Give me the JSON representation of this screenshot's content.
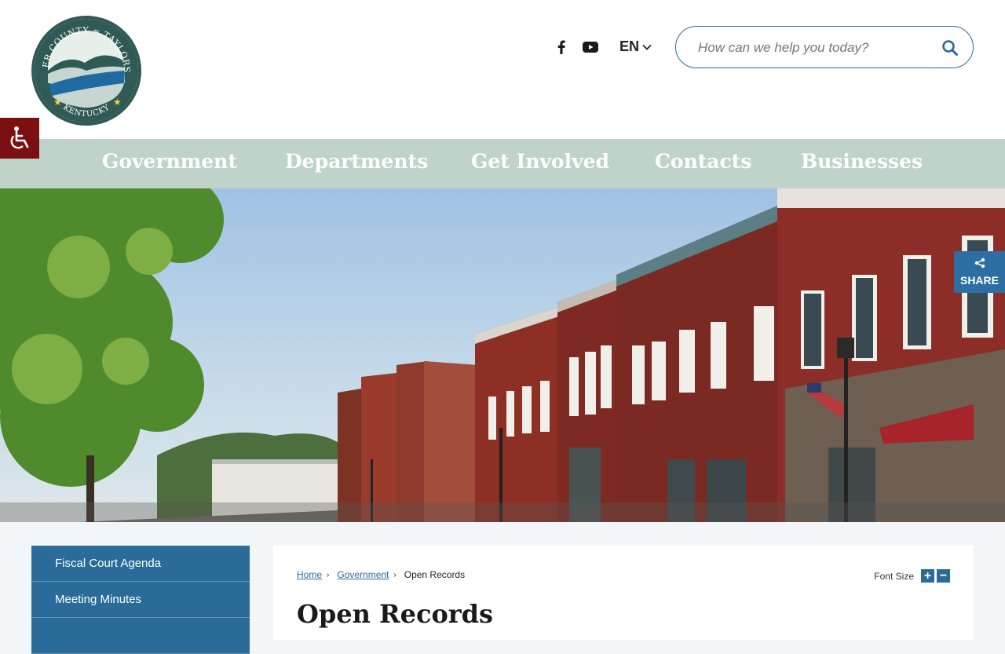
{
  "logo": {
    "top_text": "SPENCER COUNTY ≈ TAYLORSVILLE",
    "bottom_text": "KENTUCKY"
  },
  "header": {
    "social": [
      {
        "icon": "facebook-icon"
      },
      {
        "icon": "youtube-icon"
      }
    ],
    "language": "EN",
    "search_placeholder": "How can we help you today?"
  },
  "nav": {
    "items": [
      "Government",
      "Departments",
      "Get Involved",
      "Contacts",
      "Businesses"
    ]
  },
  "share": {
    "label": "SHARE"
  },
  "sidebar": {
    "items": [
      "Fiscal Court Agenda",
      "Meeting Minutes"
    ]
  },
  "breadcrumb": {
    "home": "Home",
    "parent": "Government",
    "current": "Open Records"
  },
  "font_size": {
    "label": "Font Size"
  },
  "page": {
    "title": "Open Records"
  },
  "colors": {
    "nav_bg": "#bfd3cb",
    "accent_blue": "#2a6b9a",
    "access_red": "#7a1012"
  }
}
